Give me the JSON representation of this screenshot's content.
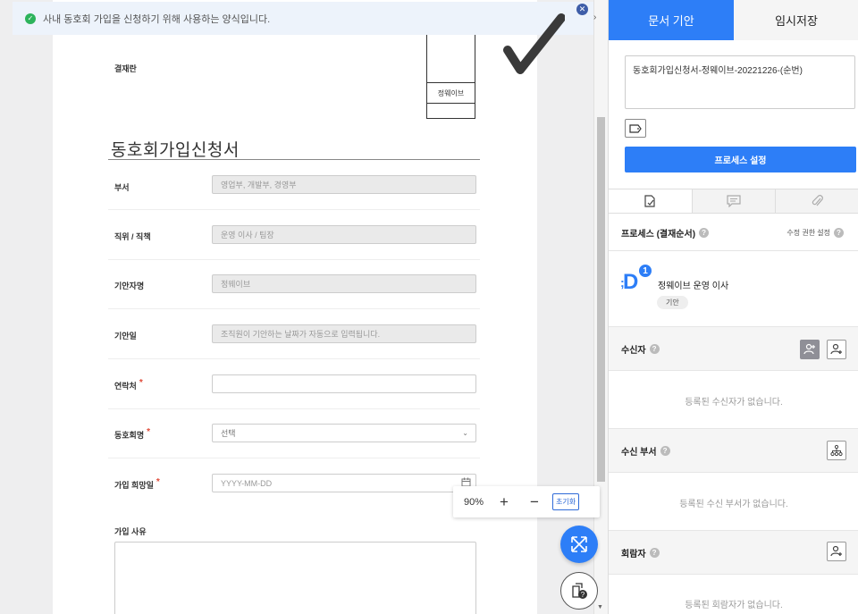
{
  "notice": {
    "text": "사내 동호회 가입을 신청하기 위해 사용하는 양식입니다."
  },
  "form": {
    "approval_label": "결재란",
    "approver_name": "정웨이브",
    "title": "동호회가입신청서",
    "fields": {
      "dept": {
        "label": "부서",
        "value": "영업부, 개발부, 경영부"
      },
      "position": {
        "label": "직위 / 직책",
        "value": "운영 이사 / 팀장"
      },
      "drafter": {
        "label": "기안자명",
        "value": "정웨이브"
      },
      "draft_date": {
        "label": "기안일",
        "value": "조직원이 기안하는 날짜가 자동으로 입력됩니다."
      },
      "contact": {
        "label": "연락처",
        "value": ""
      },
      "club": {
        "label": "동호회명",
        "value": "선택"
      },
      "join_date": {
        "label": "가입 희망일",
        "placeholder": "YYYY-MM-DD"
      },
      "reason": {
        "label": "가입 사유"
      }
    },
    "required_mark": "*"
  },
  "zoom": {
    "level": "90%",
    "plus": "+",
    "minus": "−",
    "reset": "초기화"
  },
  "right": {
    "tab_draft": "문서 기안",
    "tab_temp": "임시저장",
    "subject": "동호회가입신청서-정웨이브-20221226-(순번)",
    "process_button": "프로세스 설정",
    "process": {
      "title": "프로세스 (결재순서)",
      "perm": "수정 권한 설정",
      "step_number": "1",
      "avatar_letter": "D",
      "name": "정웨이브 운영 이사",
      "role": "기안"
    },
    "receivers": {
      "title": "수신자",
      "empty": "등록된 수신자가 없습니다."
    },
    "receiver_dept": {
      "title": "수신 부서",
      "empty": "등록된 수신 부서가 없습니다."
    },
    "reviewers": {
      "title": "회람자",
      "empty": "등록된 회람자가 없습니다."
    },
    "help": "?"
  },
  "colors": {
    "accent": "#2d7ef7",
    "notice_bg": "#edf3fb",
    "success": "#2db35b",
    "required": "#e04b3a"
  }
}
